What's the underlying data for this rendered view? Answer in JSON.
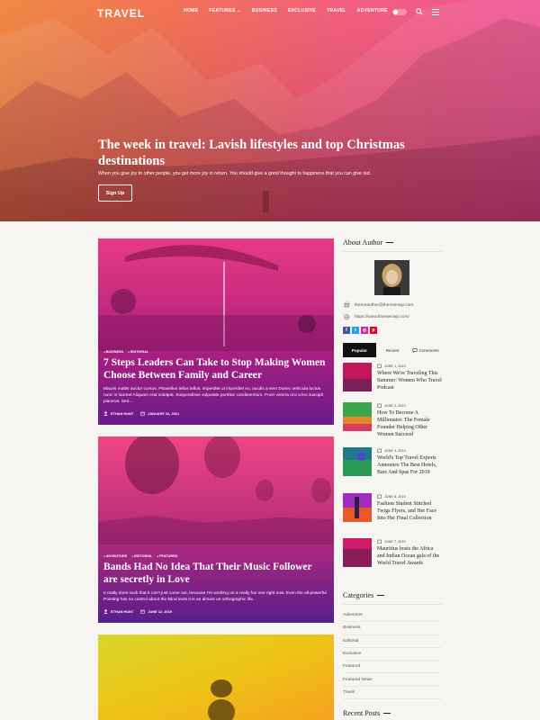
{
  "nav": {
    "logo": "TRAVEL",
    "items": [
      "HOME",
      "FEATURES ⌄",
      "BUSINESS",
      "EXCLUSIVE",
      "TRAVEL",
      "ADVENTURE"
    ]
  },
  "hero": {
    "title": "The week in travel: Lavish lifestyles and top Christmas destinations",
    "subtitle": "When you give joy to other people, you get more joy in return. You should give a good thought to happiness that you can give out.",
    "button": "Sign Up"
  },
  "posts": [
    {
      "categories": [
        "BUSINESS",
        "EDITORIAL"
      ],
      "title": "7 Steps Leaders Can Take to Stop Making Women Choose Between Family and Career",
      "excerpt": "Mauris mattis auctor cursus. Phasellus tellus tellus, imperdiet ut imperdiet eu, iaculis a sem Donec vehicula luctus nunc in laoreet Aliquam erat volutpat. Suspendisse vulputate porttitor condimentum. Proin viverra orci a leo suscipit placerat. Sed...",
      "author": "ETHAN HUNT",
      "date": "JANUARY 22, 2021"
    },
    {
      "categories": [
        "ADVENTURE",
        "EDITORIAL",
        "FEATURED"
      ],
      "title": "Bands Had No Idea That Their Music Follower are secretly in Love",
      "excerpt": "It really does suck that it can't just come out, because I'm working on a really fun one right now. Even the all-powerful Pointing has no control about the blind texts it is an almost un orthographic life.",
      "author": "ETHAN HUNT",
      "date": "JUNE 12, 2019"
    }
  ],
  "sidebar": {
    "about_heading": "About Author",
    "email": "themeauthor@themeinwp.com",
    "website": "https://www.themeinwp.com/",
    "tabs": [
      "Popular",
      "Recent",
      "Comments"
    ],
    "recent_posts": [
      {
        "date": "JUNE 1, 2019",
        "title": "Where We're Traveling This Summer: Women Who Travel Podcast"
      },
      {
        "date": "JUNE 2, 2019",
        "title": "How To Become A Millionaire: The Female Founder Helping Other Women Succeed"
      },
      {
        "date": "JUNE 4, 2019",
        "title": "World's Top Travel Experts Announce The Best Hotels, Bars And Spas For 2019"
      },
      {
        "date": "JUNE 5, 2019",
        "title": "Fashion Student Stitched Twigs Flyers, and Her Face Into Her Final Collection"
      },
      {
        "date": "JUNE 7, 2019",
        "title": "Mauritius hosts the Africa and Indian Ocean gala of the World Travel Awards"
      }
    ],
    "categories_heading": "Categories",
    "categories": [
      "Adventure",
      "Business",
      "Editorial",
      "Exclusive",
      "Featured",
      "Featured News",
      "Travel"
    ],
    "recent_heading": "Recent Posts"
  },
  "colors": {
    "accent_pink": "#ee3d8c",
    "accent_orange": "#ef7a2e",
    "dark": "#111111"
  }
}
